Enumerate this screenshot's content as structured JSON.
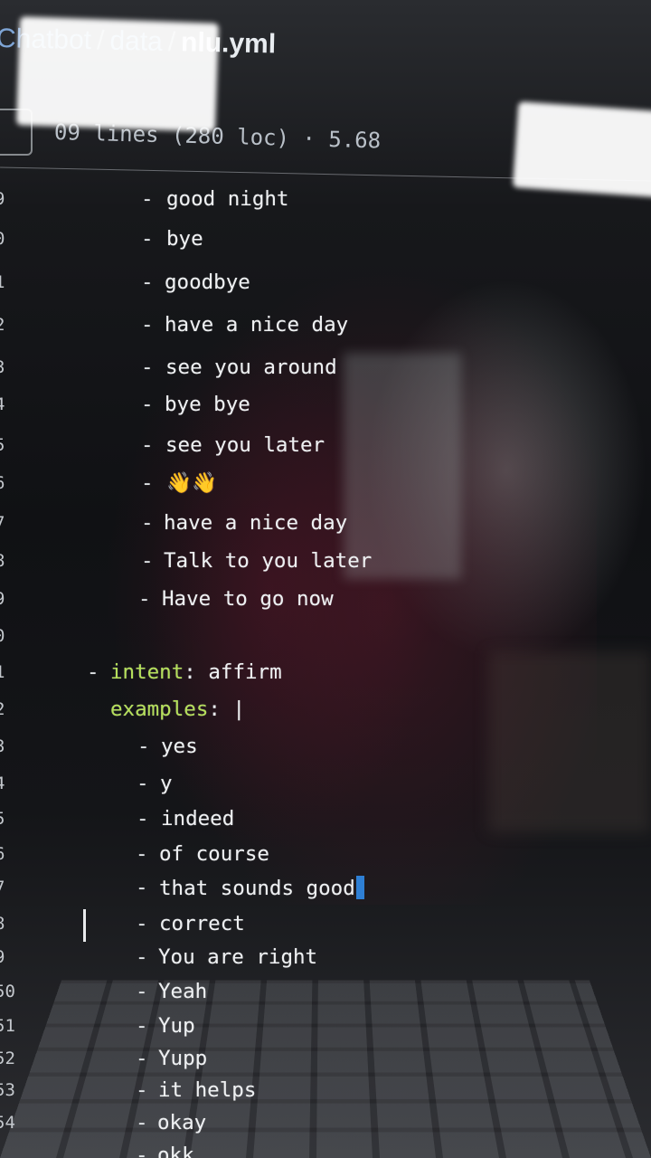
{
  "header": {
    "breadcrumb": {
      "repo": "Chatbot",
      "folder": "data",
      "file": "nlu.yml"
    },
    "file_meta": "09 lines (280 loc) · 5.68"
  },
  "code": {
    "lines": [
      {
        "num": "9",
        "text": "good night"
      },
      {
        "num": "0",
        "text": "bye"
      },
      {
        "num": "1",
        "text": "goodbye"
      },
      {
        "num": "2",
        "text": "have a nice day"
      },
      {
        "num": "3",
        "text": "see you around"
      },
      {
        "num": "4",
        "text": "bye bye"
      },
      {
        "num": "5",
        "text": "see you later"
      },
      {
        "num": "6",
        "text": "👋👋"
      },
      {
        "num": "7",
        "text": "have a nice day"
      },
      {
        "num": "8",
        "text": "Talk to you later"
      },
      {
        "num": "9",
        "text": "Have to go now"
      },
      {
        "num": "0",
        "text": ""
      },
      {
        "num": "1",
        "key": "intent",
        "value": "affirm"
      },
      {
        "num": "2",
        "key": "examples",
        "value": "|"
      },
      {
        "num": "3",
        "text": "yes"
      },
      {
        "num": "4",
        "text": "y"
      },
      {
        "num": "5",
        "text": "indeed"
      },
      {
        "num": "6",
        "text": "of course"
      },
      {
        "num": "7",
        "text": "that sounds good"
      },
      {
        "num": "8",
        "text": "correct"
      },
      {
        "num": "9",
        "text": "You are right"
      },
      {
        "num": "50",
        "text": "Yeah"
      },
      {
        "num": "51",
        "text": "Yup"
      },
      {
        "num": "52",
        "text": "Yupp"
      },
      {
        "num": "53",
        "text": "it helps"
      },
      {
        "num": "54",
        "text": "okay"
      },
      {
        "num": "",
        "text": "okk"
      }
    ]
  },
  "colors": {
    "key": "#b5e05a",
    "text": "#eef0f2",
    "link": "#7ea5d6",
    "cursor": "#2e7fd4"
  }
}
